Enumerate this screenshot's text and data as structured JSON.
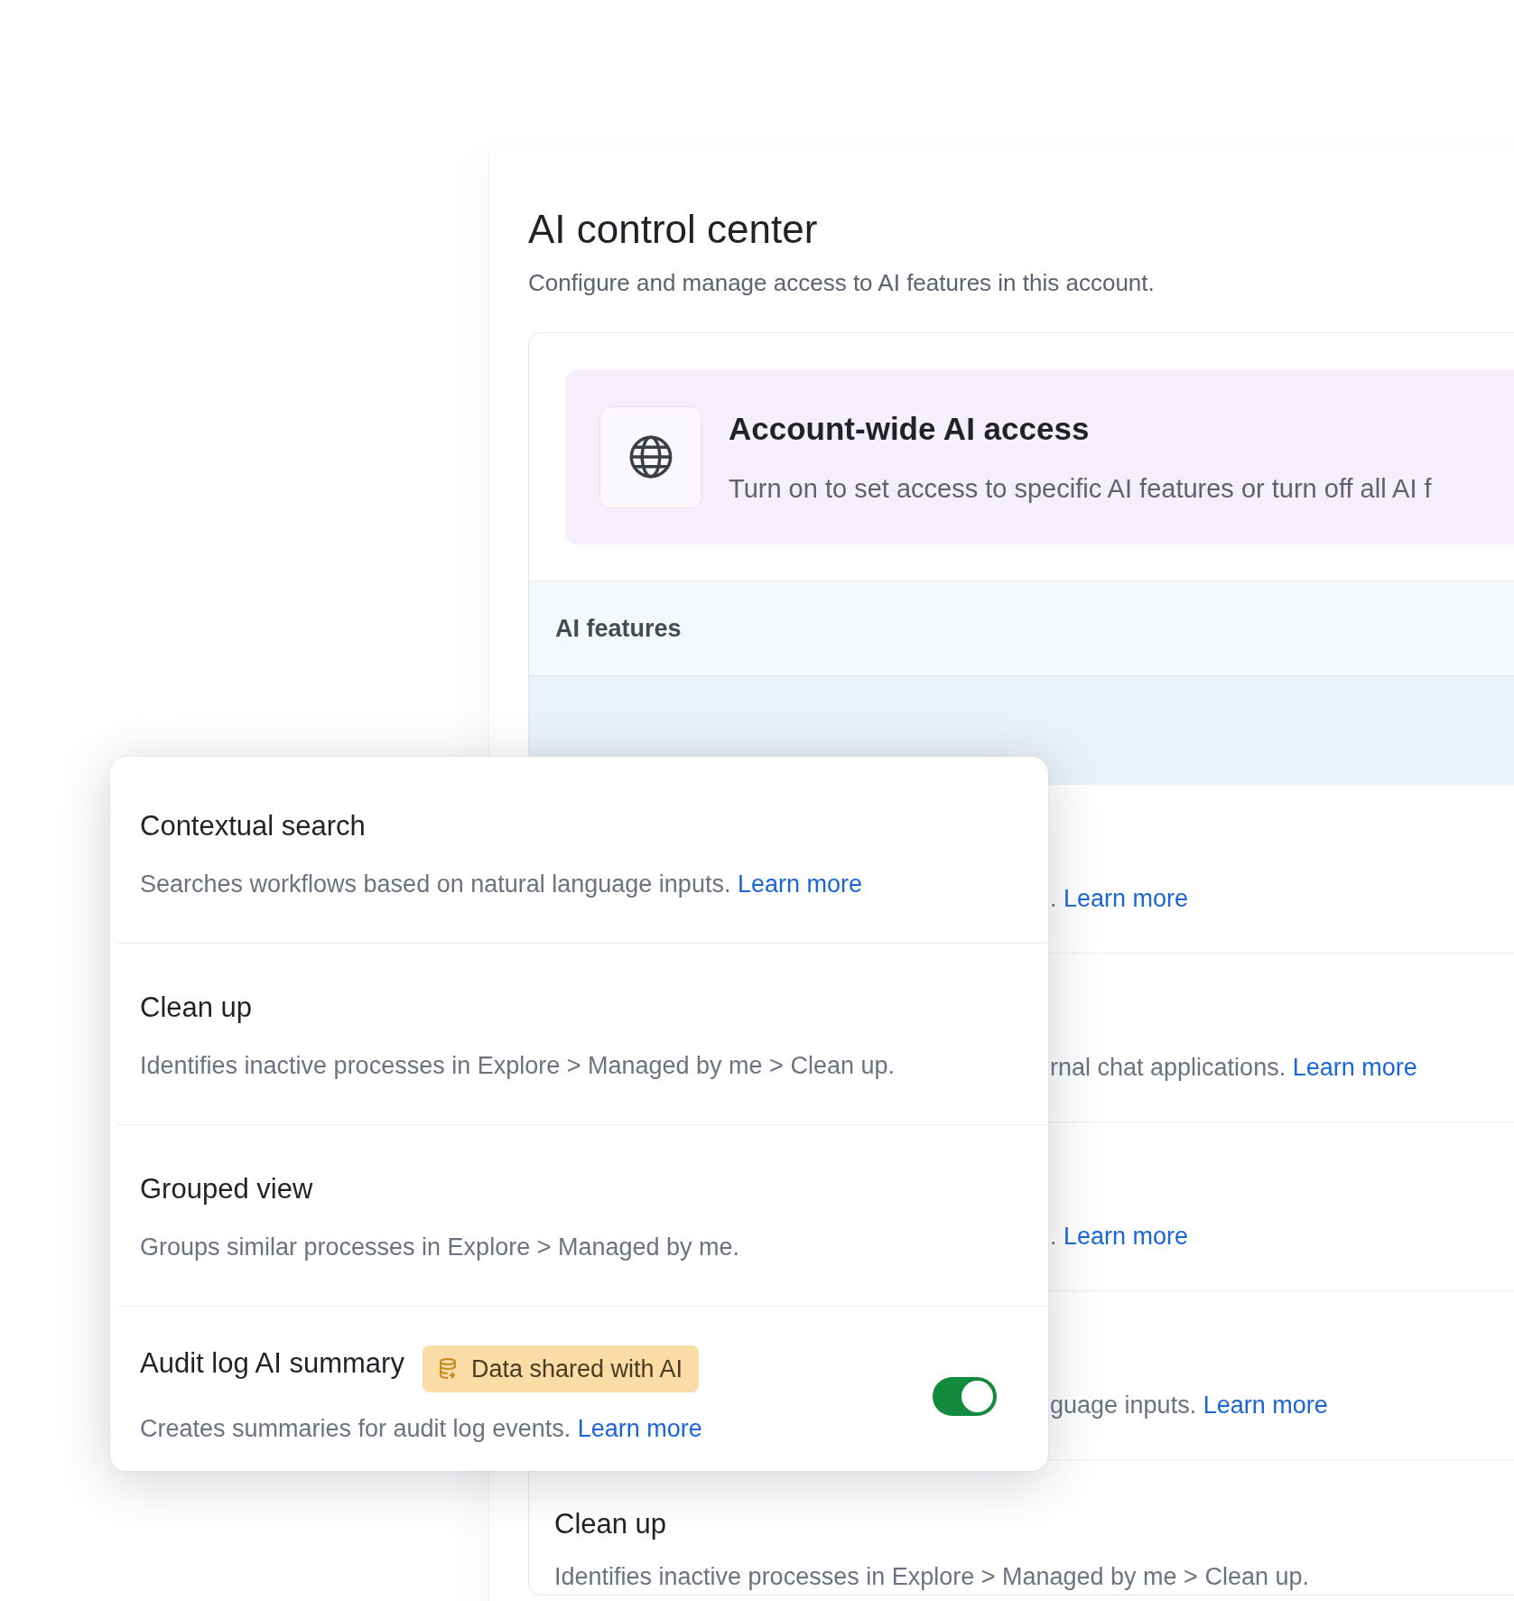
{
  "page": {
    "title": "AI control center",
    "subtitle": "Configure and manage access to AI features in this account."
  },
  "access_banner": {
    "title": "Account-wide AI access",
    "description": "Turn on to set access to specific AI features or turn off all AI f"
  },
  "features_header": "AI features",
  "background_rows": [
    {
      "kind": "partial",
      "description": ".",
      "link": "Learn more"
    },
    {
      "kind": "partial",
      "description": "rnal chat applications.",
      "link": "Learn more"
    },
    {
      "kind": "partial",
      "description": ".",
      "link": "Learn more"
    },
    {
      "kind": "partial",
      "description": "guage inputs.",
      "link": "Learn more"
    },
    {
      "kind": "full",
      "title": "Clean up",
      "description": "Identifies inactive processes in Explore > Managed by me > Clean up."
    }
  ],
  "popover": {
    "features": [
      {
        "kind": "plain",
        "title": "Contextual search",
        "description": "Searches workflows based on natural language inputs.",
        "link": "Learn more"
      },
      {
        "kind": "plain",
        "title": "Clean up",
        "description": "Identifies inactive processes in Explore > Managed by me > Clean up."
      },
      {
        "kind": "plain",
        "title": "Grouped view",
        "description": "Groups similar processes in Explore > Managed by me."
      },
      {
        "kind": "toggle",
        "title": "Audit log AI summary",
        "badge": "Data shared with AI",
        "description": "Creates summaries for audit log events.",
        "link": "Learn more",
        "on": true
      }
    ]
  }
}
